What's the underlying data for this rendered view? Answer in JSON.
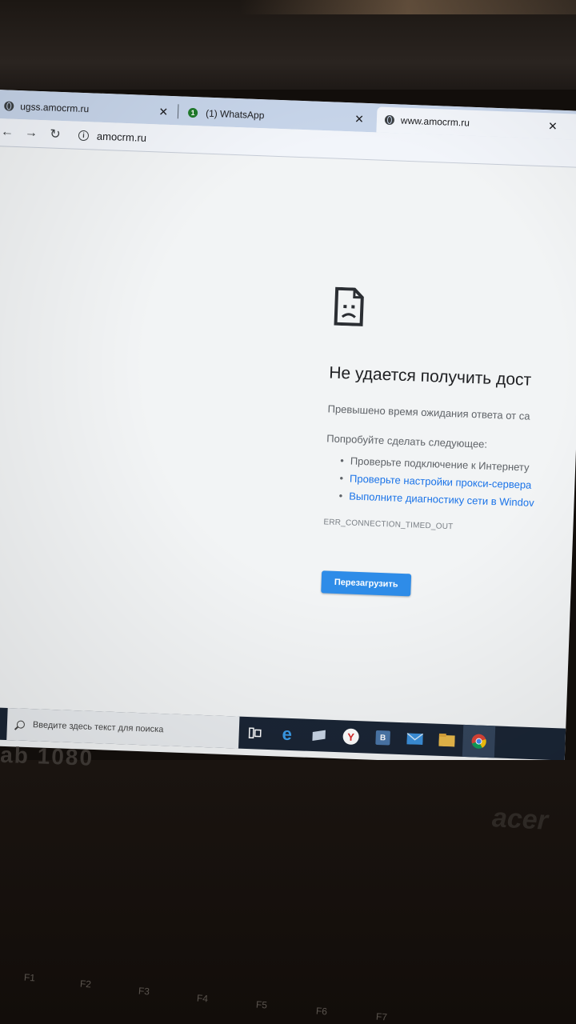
{
  "browser": {
    "tabs": [
      {
        "title": "ugss.amocrm.ru",
        "favicon": "globe-icon"
      },
      {
        "title": "(1) WhatsApp",
        "favicon": "whatsapp-icon",
        "badge": "1"
      },
      {
        "title": "www.amocrm.ru",
        "favicon": "globe-icon",
        "active": true
      }
    ],
    "address": {
      "url": "amocrm.ru"
    }
  },
  "error_page": {
    "title": "Не удается получить дост",
    "subtitle": "Превышено время ожидания ответа от са",
    "try_heading": "Попробуйте сделать следующее:",
    "suggestions": [
      {
        "text": "Проверьте подключение к Интернету"
      },
      {
        "text": "Проверьте настройки прокси-сервера"
      },
      {
        "text": "Выполните диагностику сети в Windov"
      }
    ],
    "error_code": "ERR_CONNECTION_TIMED_OUT",
    "reload_label": "Перезагрузить"
  },
  "taskbar": {
    "search_placeholder": "Введите здесь текст для поиска",
    "pinned_icons": [
      "task-view-icon",
      "edge-icon",
      "mail-app-icon",
      "yandex-icon",
      "vk-icon",
      "mail-icon",
      "file-explorer-icon",
      "chrome-icon"
    ],
    "vk_letter": "B"
  },
  "hardware": {
    "bezel_label": "ab 1080",
    "brand": "acer",
    "fkeys": [
      "F1",
      "F2",
      "F3",
      "F4",
      "F5",
      "F6",
      "F7"
    ]
  },
  "colors": {
    "accent": "#2e8ce8",
    "link": "#1a73e8",
    "tabstrip": "#c7d5ea",
    "taskbar": "#1a2535"
  }
}
